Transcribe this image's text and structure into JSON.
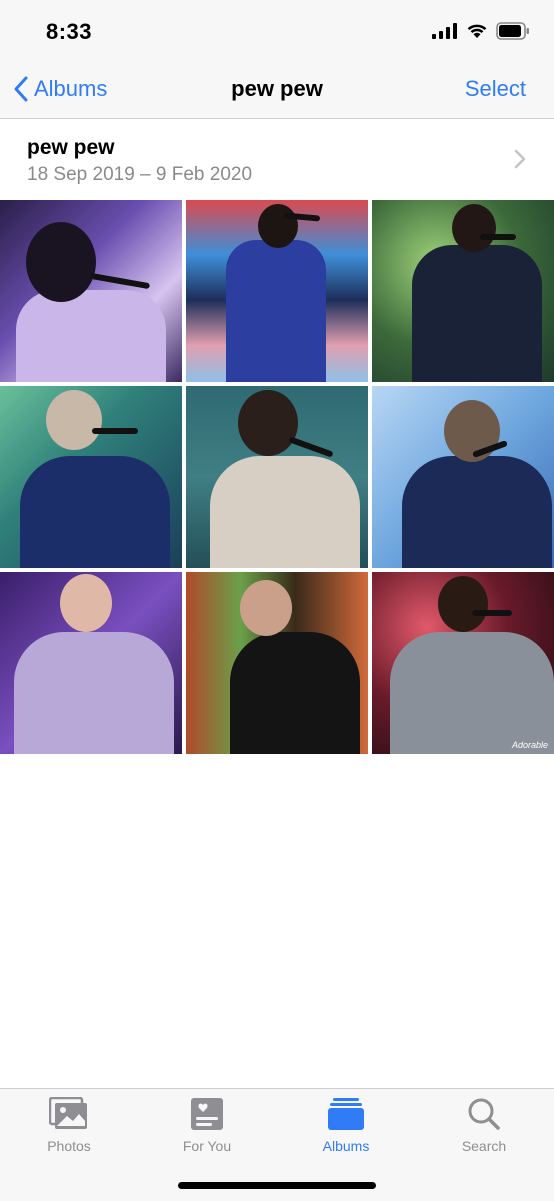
{
  "status_bar": {
    "time": "8:33"
  },
  "nav": {
    "back_label": "Albums",
    "title": "pew pew",
    "select_label": "Select"
  },
  "album": {
    "name": "pew pew",
    "date_range": "18 Sep 2019 – 9 Feb 2020"
  },
  "photos": {
    "watermark": "Adorable"
  },
  "tabs": [
    {
      "label": "Photos",
      "icon": "photos-icon",
      "active": false
    },
    {
      "label": "For You",
      "icon": "for-you-icon",
      "active": false
    },
    {
      "label": "Albums",
      "icon": "albums-icon",
      "active": true
    },
    {
      "label": "Search",
      "icon": "search-icon",
      "active": false
    }
  ],
  "colors": {
    "accent": "#2f7cf6",
    "inactive": "#8e8e93",
    "bar_bg": "#f7f7f7"
  }
}
